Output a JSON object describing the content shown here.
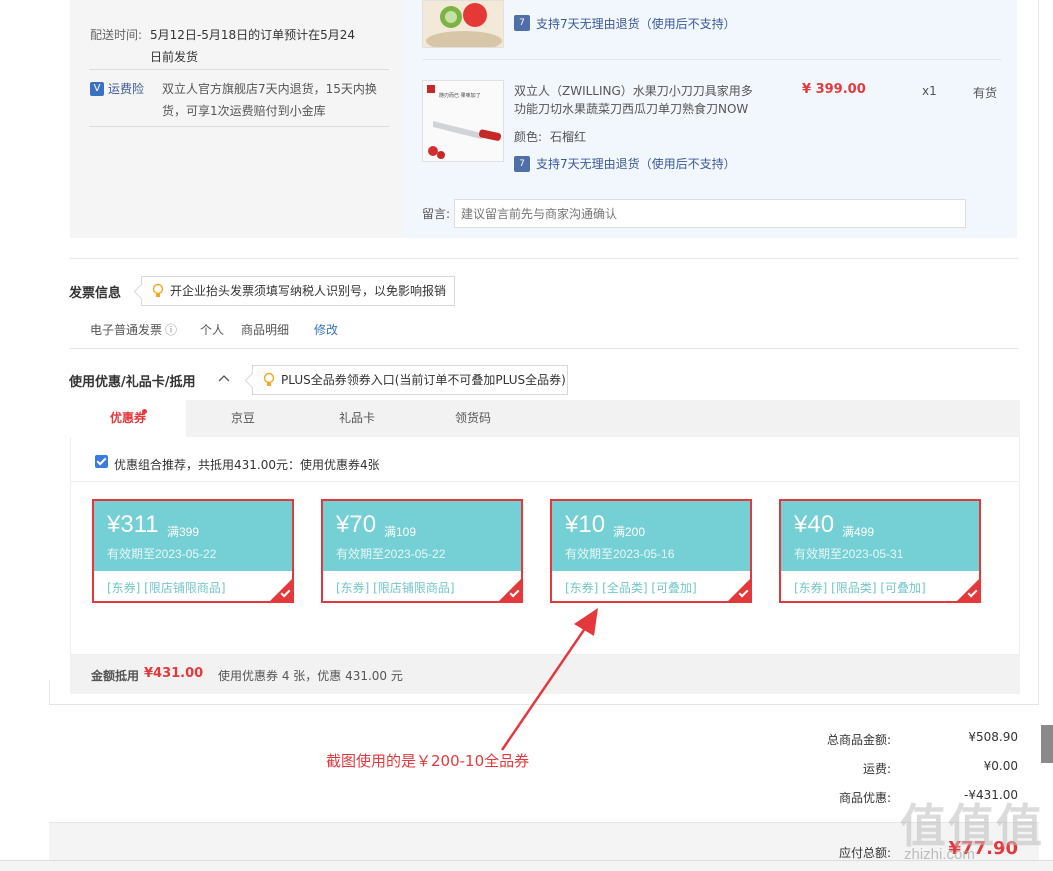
{
  "delivery": {
    "label": "配送时间:",
    "text_line1": "5月12日-5月18日的订单预计在5月24",
    "text_line2": "日前发货"
  },
  "insurance": {
    "icon_text": "V",
    "link": "运费险",
    "text_line1": "双立人官方旗舰店7天内退货，15天内换",
    "text_line2": "货，可享1次运费赔付到小金库"
  },
  "items": [
    {
      "return_policy": "支持7天无理由退货（使用后不支持）"
    },
    {
      "thumb_text": "随刃而已 果味加了",
      "title_line1": "双立人（ZWILLING）水果刀小刀刀具家用多",
      "title_line2": "功能刀切水果蔬菜刀西瓜刀单刀熟食刀NOW",
      "price": "¥ 399.00",
      "qty": "x1",
      "stock": "有货",
      "color_label": "颜色:",
      "color_value": "石榴红",
      "return_policy": "支持7天无理由退货（使用后不支持）"
    }
  ],
  "message": {
    "label": "留言:",
    "placeholder": "建议留言前先与商家沟通确认"
  },
  "invoice": {
    "title": "发票信息",
    "tip": "开企业抬头发票须填写纳税人识别号，以免影响报销",
    "type": "电子普通发票",
    "info_icon": "ⓘ",
    "owner": "个人",
    "content": "商品明细",
    "edit": "修改"
  },
  "discount": {
    "title": "使用优惠/礼品卡/抵用",
    "tip": "PLUS全品券领券入口(当前订单不可叠加PLUS全品券)",
    "tabs": [
      "优惠券",
      "京豆",
      "礼品卡",
      "领货码"
    ],
    "active_tab": "优惠券",
    "combo_label": "优惠组合推荐，共抵用431.00元：使用优惠券4张",
    "coupons": [
      {
        "amount": "¥311",
        "cond": "满399",
        "valid": "有效期至2023-05-22",
        "tags": "[东券]  [限店铺限商品]"
      },
      {
        "amount": "¥70",
        "cond": "满109",
        "valid": "有效期至2023-05-22",
        "tags": "[东券]  [限店铺限商品]"
      },
      {
        "amount": "¥10",
        "cond": "满200",
        "valid": "有效期至2023-05-16",
        "tags": "[东券]  [全品类]  [可叠加]"
      },
      {
        "amount": "¥40",
        "cond": "满499",
        "valid": "有效期至2023-05-31",
        "tags": "[东券]  [限品类]  [可叠加]"
      }
    ],
    "summary_label": "金额抵用",
    "summary_amount": "¥431.00",
    "summary_text": "使用优惠券 4 张，优惠 431.00 元"
  },
  "annotation": "截图使用的是￥200-10全品券",
  "totals": {
    "goods_label": "总商品金额:",
    "goods_value": "¥508.90",
    "shipping_label": "运费:",
    "shipping_value": "¥0.00",
    "discount_label": "商品优惠:",
    "discount_value": "-¥431.00",
    "payable_label": "应付总额:",
    "payable_value": "¥77.90"
  },
  "watermark": {
    "main": "值",
    "sub": "zhizhi.com"
  },
  "colors": {
    "accent_red": "#e4393c",
    "coupon_teal": "#74d0d4",
    "link_blue": "#3b5998"
  }
}
